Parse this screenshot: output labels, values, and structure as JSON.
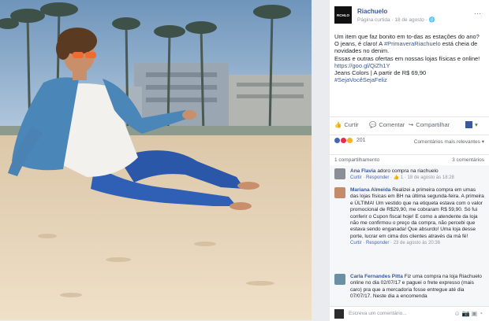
{
  "page": {
    "name": "Riachuelo",
    "logo_text": "RCHLO",
    "subtitle": "Página curtida · 18 de agosto · ",
    "more": "···"
  },
  "post": {
    "text_main": "Um item que faz bonito em to-das as estações do ano? O jeans, é claro! A ",
    "hashtag1": "#PrimaveraRiachuelo",
    "text_after": " está cheia de novidades no denim.",
    "text_offer": "Essas e outras ofertas em nossas lojas físicas e online! ",
    "link": "https://goo.gl/QiZh1Y",
    "price_line": "Jeans Colors | A partir de R$ 69,90",
    "hashtag2": "#SejaVocêSejaFeliz"
  },
  "actions": {
    "like": "Curtir",
    "comment": "Comentar",
    "share": "Compartilhar"
  },
  "reactions": {
    "count": "201",
    "sort_label": "Comentários mais relevantes ▾"
  },
  "shares": {
    "count_text": "1 compartilhamento",
    "comments_text": "3 comentários"
  },
  "comments": [
    {
      "author": "Ana Flavia",
      "text": " adoro compra na riachuelo",
      "like": "Curtir",
      "reply": "Responder",
      "meta": " · 👍 1 · 18 de agosto às 18:28"
    },
    {
      "author": "Mariana Almeida",
      "text": " Realizei a primeira compra em umas das lojas físicas em BH na última segunda-feira. A primeira e ÚLTIMA! Um vestido que na etiqueta estava com o valor promocional de R$29,90, me cobraram R$ 59,90. Só fui conferir o Cupon fiscal hoje! E como a atendente da loja não me confirmou o preço da compra, não percebi que estava sendo enganada! Que absurdo! Uma loja desse porte, lucrar em cima dos clientes através da má fé!",
      "like": "Curtir",
      "reply": "Responder",
      "meta": " · 23 de agosto às 20:36"
    },
    {
      "author": "Carla Fernandes Pitta",
      "text": " Fiz uma compra na loja Riachuelo online no dia 02/07/17 e paguei o frete expresso (mais caro) pra que a mercadoria fosse entregue até dia 07/07/17. Neste dia a encomenda",
      "like": "",
      "reply": "",
      "meta": ""
    }
  ],
  "write_comment": {
    "placeholder": "Escreva um comentário..."
  },
  "colors": {
    "link": "#365899",
    "accent": "#4267b2",
    "muted": "#90949c",
    "bg": "#e9ebee"
  }
}
